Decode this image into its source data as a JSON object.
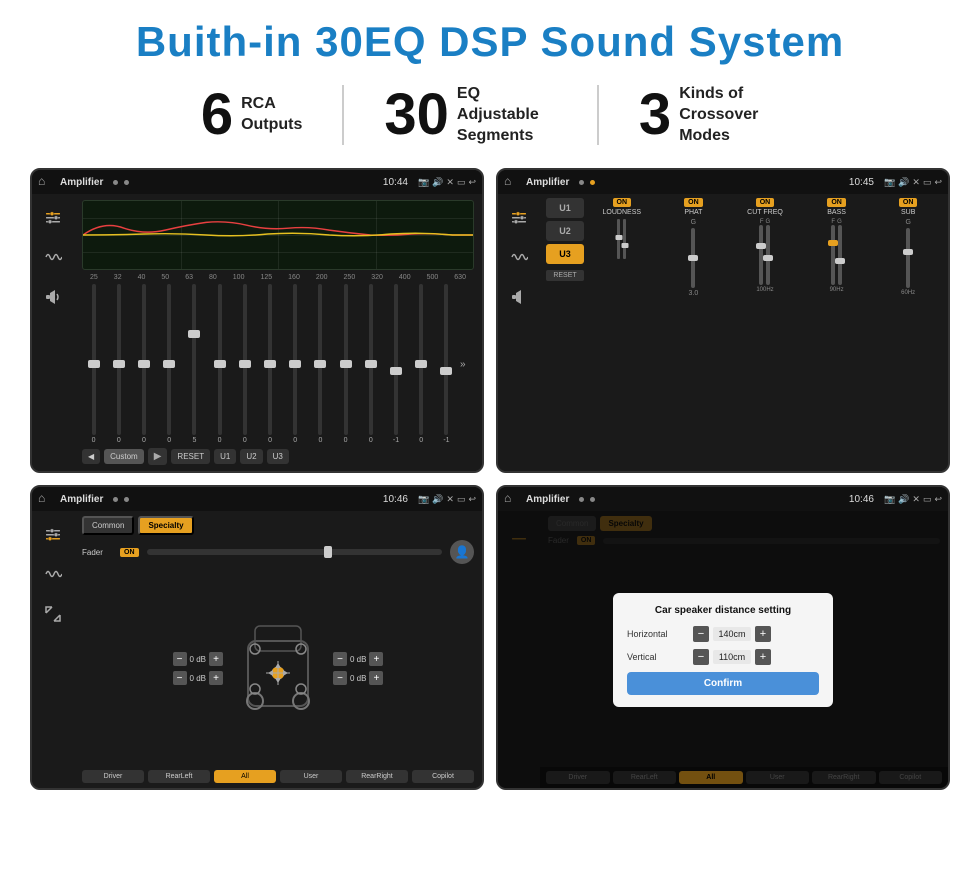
{
  "page": {
    "title": "Buith-in 30EQ DSP Sound System",
    "stats": [
      {
        "number": "6",
        "label": "RCA\nOutputs"
      },
      {
        "number": "30",
        "label": "EQ Adjustable\nSegments"
      },
      {
        "number": "3",
        "label": "Kinds of\nCrossover Modes"
      }
    ],
    "screens": [
      {
        "id": "eq-screen",
        "time": "10:44",
        "app": "Amplifier",
        "type": "eq"
      },
      {
        "id": "crossover-screen",
        "time": "10:45",
        "app": "Amplifier",
        "type": "crossover"
      },
      {
        "id": "fader-screen",
        "time": "10:46",
        "app": "Amplifier",
        "type": "fader"
      },
      {
        "id": "dialog-screen",
        "time": "10:46",
        "app": "Amplifier",
        "type": "dialog"
      }
    ],
    "eq": {
      "freqs": [
        "25",
        "32",
        "40",
        "50",
        "63",
        "80",
        "100",
        "125",
        "160",
        "200",
        "250",
        "320",
        "400",
        "500",
        "630"
      ],
      "values": [
        "0",
        "0",
        "0",
        "0",
        "5",
        "0",
        "0",
        "0",
        "0",
        "0",
        "0",
        "0",
        "-1",
        "0",
        "-1"
      ],
      "preset": "Custom",
      "buttons": [
        "RESET",
        "U1",
        "U2",
        "U3"
      ]
    },
    "crossover": {
      "units": [
        "U1",
        "U2",
        "U3"
      ],
      "channels": [
        "LOUDNESS",
        "PHAT",
        "CUT FREQ",
        "BASS",
        "SUB"
      ],
      "resetLabel": "RESET"
    },
    "fader": {
      "tabs": [
        "Common",
        "Specialty"
      ],
      "activeTab": "Specialty",
      "faderLabel": "Fader",
      "dbValues": [
        "0 dB",
        "0 dB",
        "0 dB",
        "0 dB"
      ],
      "bottomButtons": [
        "Driver",
        "RearLeft",
        "All",
        "User",
        "RearRight",
        "Copilot"
      ]
    },
    "dialog": {
      "title": "Car speaker distance setting",
      "horizontal": "140cm",
      "vertical": "110cm",
      "confirmLabel": "Confirm"
    }
  }
}
